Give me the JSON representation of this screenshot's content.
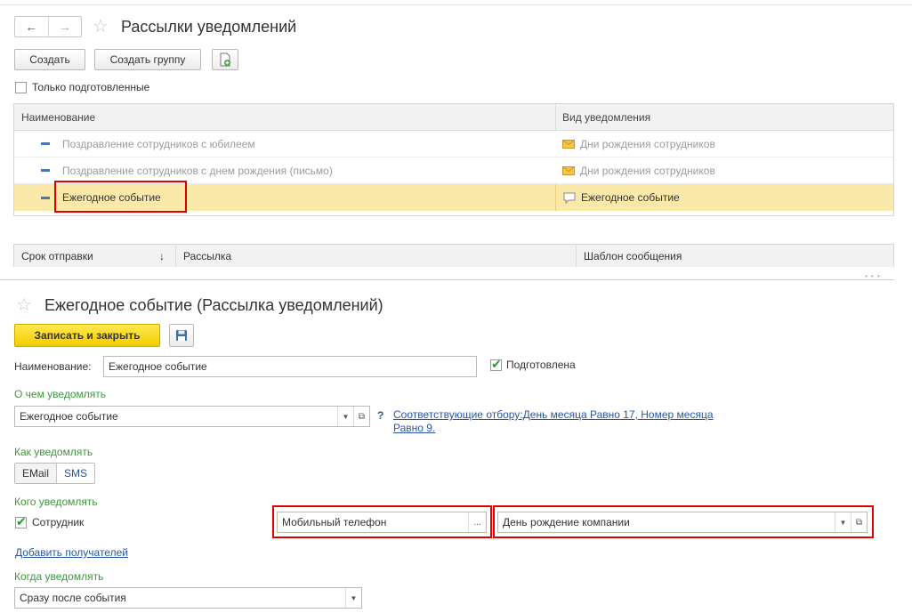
{
  "list_window": {
    "title": "Рассылки уведомлений",
    "nav": {
      "back_glyph": "←",
      "forward_glyph": "→"
    },
    "toolbar": {
      "create_label": "Создать",
      "create_group_label": "Создать группу"
    },
    "filter": {
      "label": "Только подготовленные",
      "checked": false
    },
    "table": {
      "columns": [
        "Наименование",
        "Вид уведомления"
      ],
      "rows": [
        {
          "name": "Поздравление сотрудников с юбилеем",
          "kind": "Дни рождения сотрудников",
          "kind_icon": "envelope-icon",
          "muted": true,
          "selected": false
        },
        {
          "name": "Поздравление сотрудников с днем рождения (письмо)",
          "kind": "Дни рождения сотрудников",
          "kind_icon": "envelope-icon",
          "muted": true,
          "selected": false
        },
        {
          "name": "Ежегодное событие",
          "kind": "Ежегодное событие",
          "kind_icon": "speech-bubble-icon",
          "muted": false,
          "selected": true
        }
      ]
    },
    "sub_table": {
      "columns": [
        "Срок отправки",
        "Рассылка",
        "Шаблон сообщения"
      ],
      "sort_glyph": "↓"
    }
  },
  "form": {
    "title": "Ежегодное событие (Рассылка уведомлений)",
    "save_close_label": "Записать и закрыть",
    "name_label": "Наименование:",
    "name_value": "Ежегодное событие",
    "prepared_label": "Подготовлена",
    "prepared_checked": true,
    "what_label": "О чем уведомлять",
    "what_value": "Ежегодное событие",
    "help_glyph": "?",
    "filter_link_line1": "Соответствующие отбору:День месяца Равно 17, Номер месяца",
    "filter_link_line2": "Равно 9.",
    "how_label": "Как уведомлять",
    "how_options": [
      "EMail",
      "SMS"
    ],
    "how_selected": "SMS",
    "whom_label": "Кого уведомлять",
    "employee_label": "Сотрудник",
    "employee_checked": true,
    "phone_field_value": "Мобильный телефон",
    "ellipsis": "...",
    "template_value": "День рождение компании",
    "add_recipients_label": "Добавить получателей",
    "when_label": "Когда уведомлять",
    "when_value": "Сразу после события"
  },
  "colors": {
    "accent_yellow": "#f7d51d",
    "selection": "#fbe9a9",
    "highlight_red": "#e00000",
    "label_green": "#3a9a3a",
    "link_blue": "#2756a6"
  }
}
